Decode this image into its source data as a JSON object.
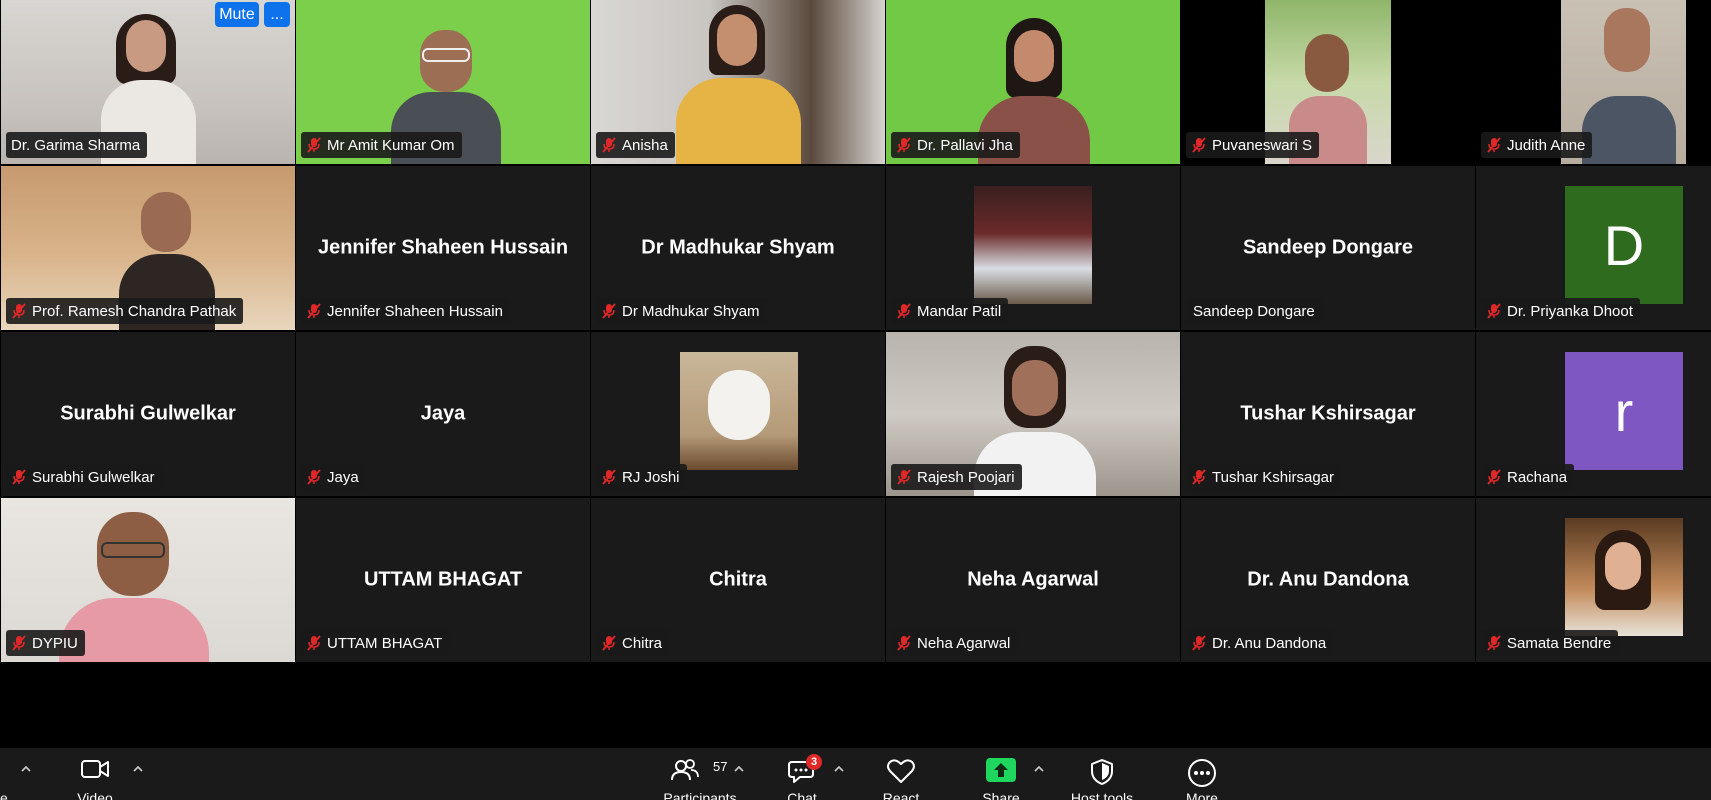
{
  "host_controls": {
    "mute_label": "Mute",
    "more_label": "..."
  },
  "tiles": [
    {
      "name": "Dr. Garima Sharma",
      "center": ""
    },
    {
      "name": "Mr Amit Kumar Om",
      "center": ""
    },
    {
      "name": "Anisha",
      "center": ""
    },
    {
      "name": "Dr. Pallavi Jha",
      "center": ""
    },
    {
      "name": "Puvaneswari S",
      "center": ""
    },
    {
      "name": "Judith Anne",
      "center": ""
    },
    {
      "name": "Prof. Ramesh Chandra Pathak",
      "center": ""
    },
    {
      "name": "Jennifer Shaheen Hussain",
      "center": "Jennifer Shaheen Hussain"
    },
    {
      "name": "Dr Madhukar Shyam",
      "center": "Dr Madhukar Shyam"
    },
    {
      "name": "Mandar Patil",
      "center": ""
    },
    {
      "name": "Sandeep Dongare",
      "center": "Sandeep Dongare"
    },
    {
      "name": "Dr. Priyanka Dhoot",
      "center": "",
      "avatar_letter": "D",
      "avatar_color": "#2e6b1f"
    },
    {
      "name": "Surabhi Gulwelkar",
      "center": "Surabhi Gulwelkar"
    },
    {
      "name": "Jaya",
      "center": "Jaya"
    },
    {
      "name": "RJ Joshi",
      "center": ""
    },
    {
      "name": "Rajesh Poojari",
      "center": ""
    },
    {
      "name": "Tushar Kshirsagar",
      "center": "Tushar Kshirsagar"
    },
    {
      "name": "Rachana",
      "center": "",
      "avatar_letter": "r",
      "avatar_color": "#7e57c2"
    },
    {
      "name": "DYPIU",
      "center": ""
    },
    {
      "name": "UTTAM BHAGAT",
      "center": "UTTAM BHAGAT"
    },
    {
      "name": "Chitra",
      "center": "Chitra"
    },
    {
      "name": "Neha Agarwal",
      "center": "Neha Agarwal"
    },
    {
      "name": "Dr. Anu Dandona",
      "center": "Dr. Anu Dandona"
    },
    {
      "name": "Samata Bendre",
      "center": ""
    }
  ],
  "toolbar": {
    "audio_label": "e",
    "video_label": "Video",
    "participants_label": "Participants",
    "participants_count": "57",
    "chat_label": "Chat",
    "chat_badge": "3",
    "react_label": "React",
    "share_label": "Share",
    "host_tools_label": "Host tools",
    "more_label": "More"
  },
  "colors": {
    "share_green": "#1fd65f",
    "active_speaker_border": "#1fd65f",
    "mute_button": "#0e72ed",
    "mic_off_red": "#e02828",
    "chat_badge": "#e02828"
  }
}
